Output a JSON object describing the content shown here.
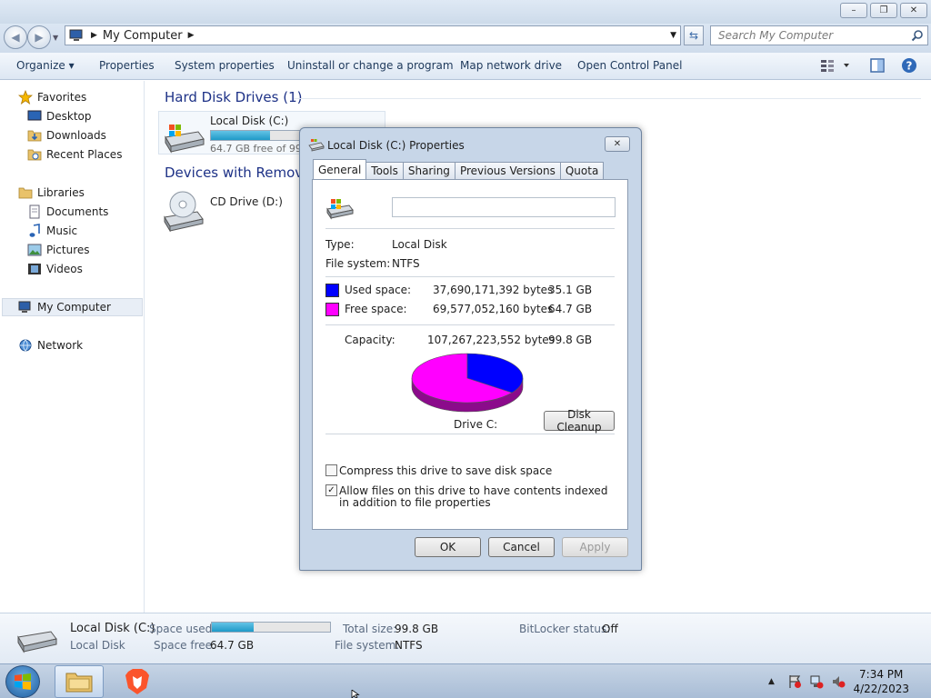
{
  "window": {
    "minimize_glyph": "–",
    "restore_glyph": "❐",
    "close_glyph": "✕"
  },
  "address": {
    "location": "My Computer",
    "search_placeholder": "Search My Computer"
  },
  "toolbar": {
    "organize": "Organize",
    "properties": "Properties",
    "system_properties": "System properties",
    "uninstall": "Uninstall or change a program",
    "map_drive": "Map network drive",
    "control_panel": "Open Control Panel"
  },
  "nav": {
    "favorites": "Favorites",
    "desktop": "Desktop",
    "downloads": "Downloads",
    "recent": "Recent Places",
    "libraries": "Libraries",
    "documents": "Documents",
    "music": "Music",
    "pictures": "Pictures",
    "videos": "Videos",
    "computer": "My Computer",
    "network": "Network"
  },
  "content": {
    "hdd_group": "Hard Disk Drives (1)",
    "removable_group": "Devices with Removable Storage (1)",
    "drive_c_name": "Local Disk (C:)",
    "drive_c_free": "64.7 GB free of 99.8 GB",
    "drive_c_used_fraction": 0.351,
    "drive_d_name": "CD Drive (D:)"
  },
  "details": {
    "name": "Local Disk (C:)",
    "type": "Local Disk",
    "space_used_label": "Space used:",
    "space_free_label": "Space free:",
    "space_free": "64.7 GB",
    "total_size_label": "Total size:",
    "total_size": "99.8 GB",
    "filesystem_label": "File system:",
    "filesystem": "NTFS",
    "bitlocker_label": "BitLocker status:",
    "bitlocker": "Off"
  },
  "dialog": {
    "title": "Local Disk (C:) Properties",
    "tabs": [
      "General",
      "Tools",
      "Sharing",
      "Previous Versions",
      "Quota"
    ],
    "type_label": "Type:",
    "type_value": "Local Disk",
    "fs_label": "File system:",
    "fs_value": "NTFS",
    "used_label": "Used space:",
    "used_bytes": "37,690,171,392 bytes",
    "used_gb": "35.1 GB",
    "free_label": "Free space:",
    "free_bytes": "69,577,052,160 bytes",
    "free_gb": "64.7 GB",
    "capacity_label": "Capacity:",
    "capacity_bytes": "107,267,223,552 bytes",
    "capacity_gb": "99.8 GB",
    "drive_label": "Drive C:",
    "cleanup_button": "Disk Cleanup",
    "compress_label": "Compress this drive to save disk space",
    "index_label": "Allow files on this drive to have contents indexed in addition to file properties",
    "ok": "OK",
    "cancel": "Cancel",
    "apply": "Apply",
    "used_color": "#0000ff",
    "free_color": "#ff00ff"
  },
  "taskbar": {
    "time": "7:34 PM",
    "date": "4/22/2023"
  }
}
